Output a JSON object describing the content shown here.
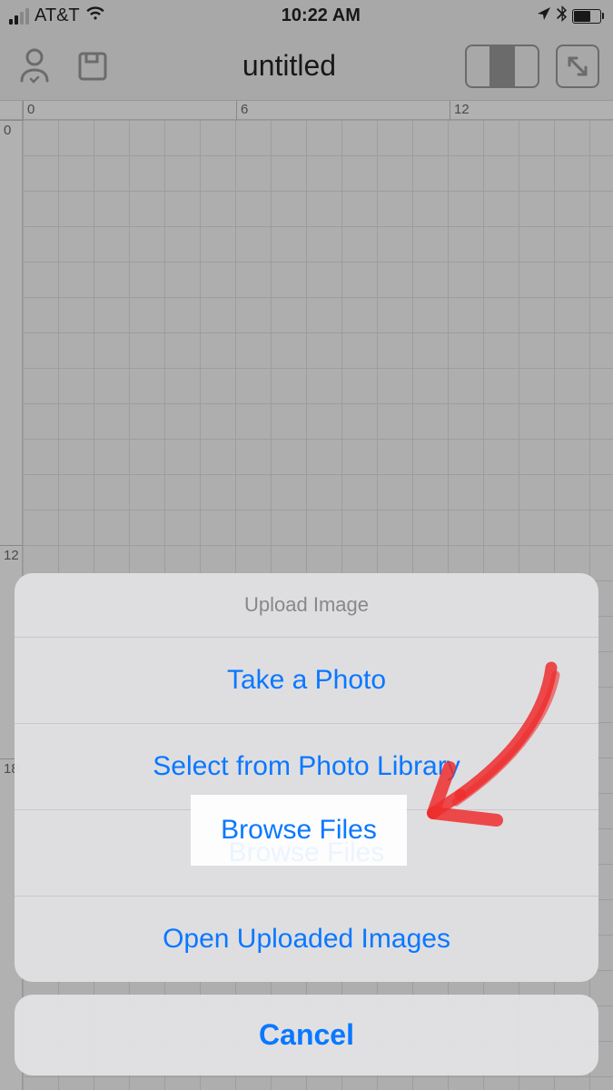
{
  "status": {
    "carrier": "AT&T",
    "time": "10:22 AM"
  },
  "toolbar": {
    "title": "untitled"
  },
  "ruler": {
    "top": [
      "0",
      "6",
      "12"
    ],
    "left": [
      "0",
      "12",
      "18"
    ]
  },
  "actionSheet": {
    "header": "Upload Image",
    "options": [
      "Take a Photo",
      "Select from Photo Library",
      "Browse Files",
      "Open Uploaded Images"
    ],
    "cancel": "Cancel",
    "highlightedOption": "Browse Files"
  }
}
